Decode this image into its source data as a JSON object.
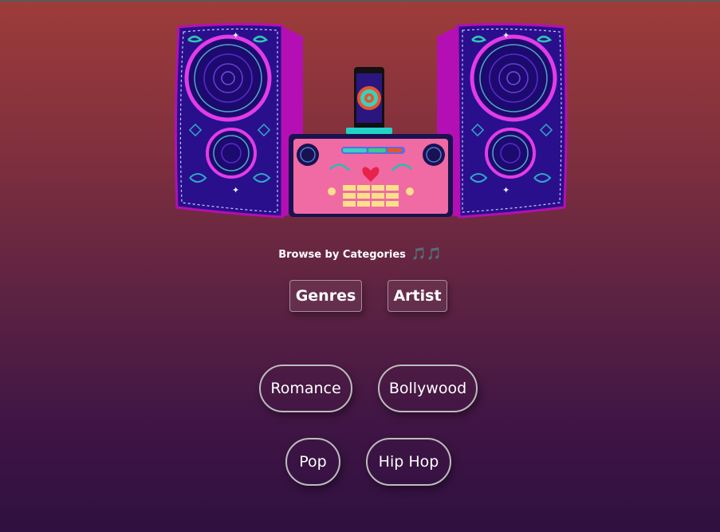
{
  "browse": {
    "caption": "Browse by Categories",
    "caption_icon": "🎵🎵"
  },
  "tabs": [
    {
      "label": "Genres"
    },
    {
      "label": "Artist"
    }
  ],
  "genres": [
    {
      "label": "Romance"
    },
    {
      "label": "Bollywood"
    },
    {
      "label": "Pop"
    },
    {
      "label": "Hip Hop"
    }
  ],
  "illustration": {
    "description_icon": "stereo-speaker-illustration"
  }
}
